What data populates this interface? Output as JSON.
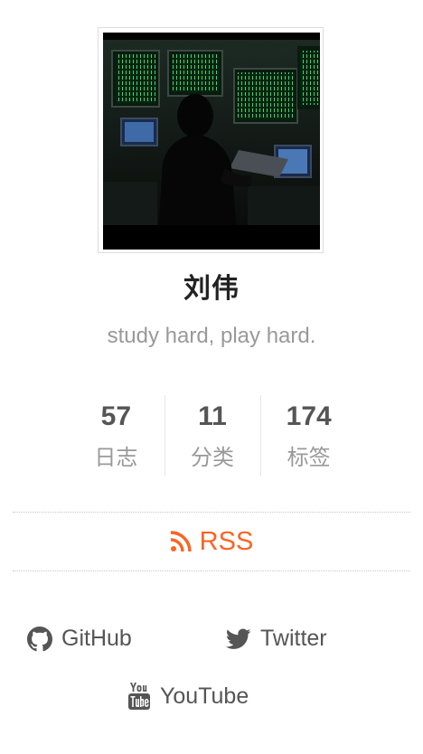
{
  "author": {
    "name": "刘伟",
    "description": "study hard, play hard.",
    "avatar_icon": "avatar-image"
  },
  "stats": [
    {
      "count": "57",
      "label": "日志"
    },
    {
      "count": "11",
      "label": "分类"
    },
    {
      "count": "174",
      "label": "标签"
    }
  ],
  "rss": {
    "label": "RSS",
    "icon": "rss-icon",
    "color": "#fc6423"
  },
  "links": [
    {
      "label": "GitHub",
      "icon": "github-icon"
    },
    {
      "label": "Twitter",
      "icon": "twitter-icon"
    },
    {
      "label": "YouTube",
      "icon": "youtube-icon"
    }
  ]
}
